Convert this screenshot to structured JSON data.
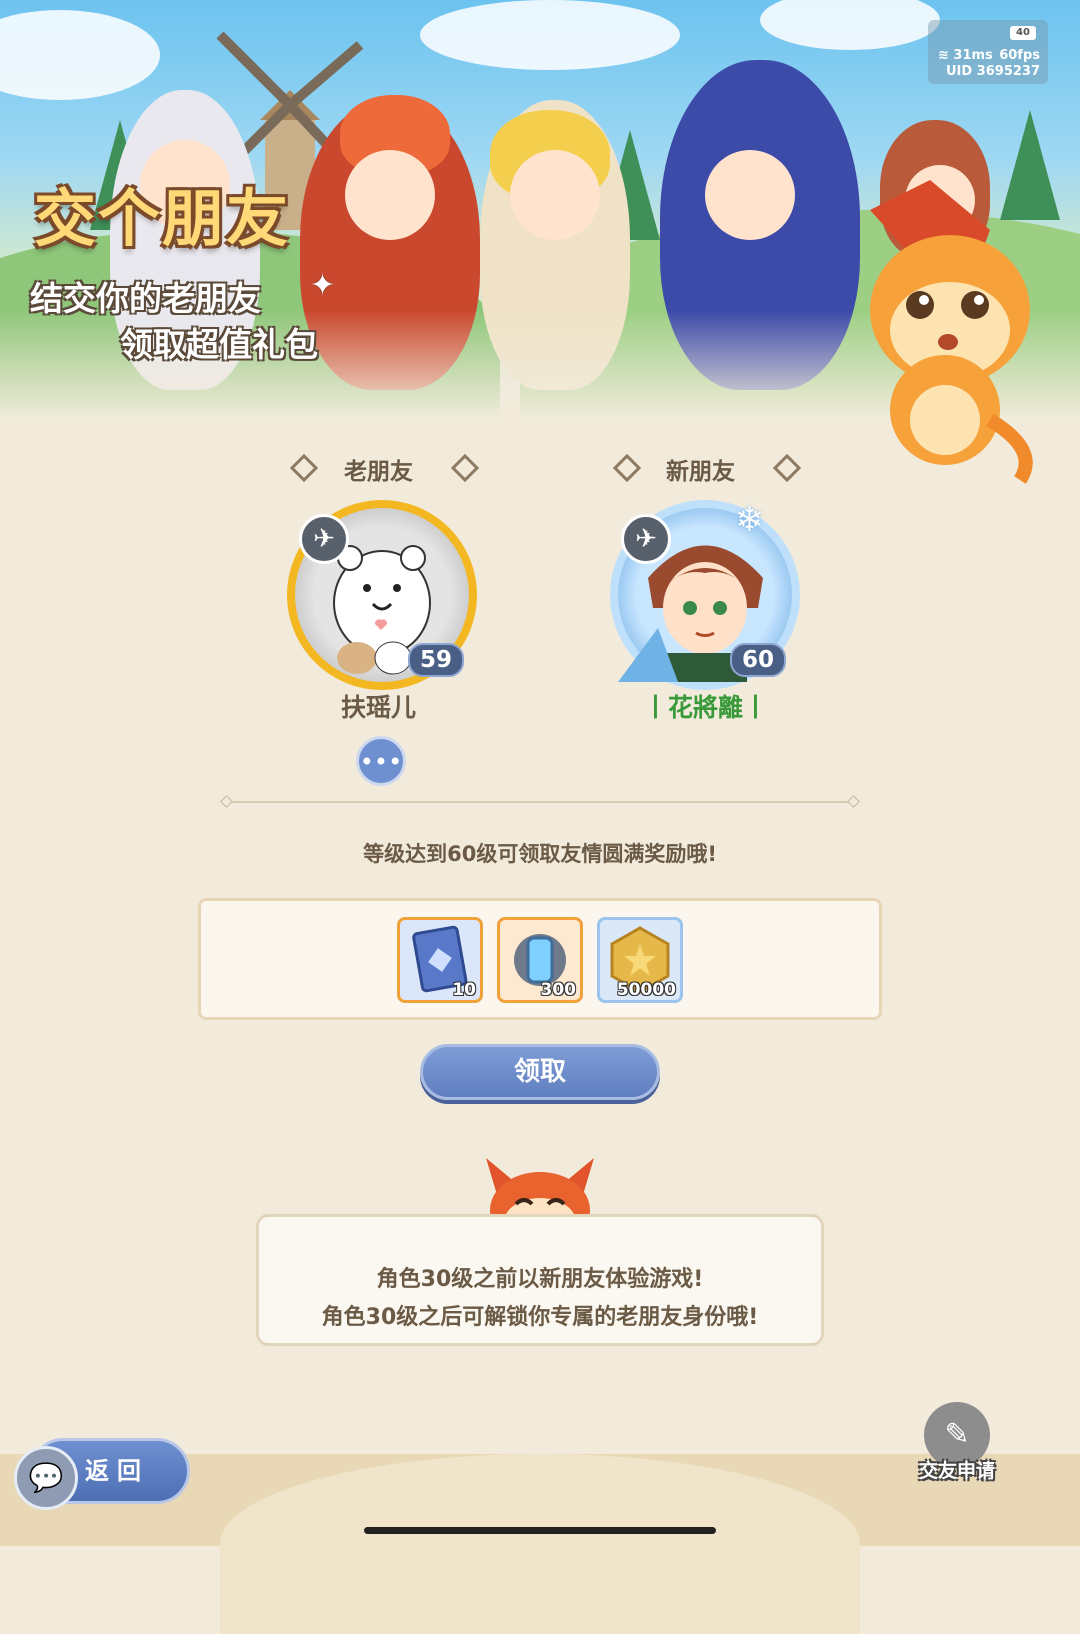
{
  "banner": {
    "title": "交个朋友",
    "subtitle_line1": "结交你的老朋友",
    "subtitle_line2": "领取超值礼包"
  },
  "status": {
    "battery": "40",
    "ping": "31ms",
    "fps": "60fps",
    "uid": "UID 3695237"
  },
  "old_friend": {
    "section_label": "老朋友",
    "name": "扶瑶儿",
    "level": "59"
  },
  "new_friend": {
    "section_label": "新朋友",
    "name": "丨花將離丨",
    "level": "60"
  },
  "reward": {
    "notice": "等级达到60级可领取友情圆满奖励哦!",
    "items": [
      {
        "icon": "card-icon",
        "count": "10"
      },
      {
        "icon": "gear-canister-icon",
        "count": "300"
      },
      {
        "icon": "gold-coin-icon",
        "count": "50000"
      }
    ],
    "claim_label": "领取"
  },
  "tip": {
    "line1": "角色30级之前以新朋友体验游戏!",
    "line2": "角色30级之后可解锁你专属的老朋友身份哦!"
  },
  "footer": {
    "back_label": "返回",
    "apply_label": "交友申请"
  },
  "colors": {
    "background": "#f2ebdc",
    "button_blue": "#5f7fc0",
    "new_friend_name": "#3a9a3a",
    "level_badge": "#4a5f86"
  }
}
